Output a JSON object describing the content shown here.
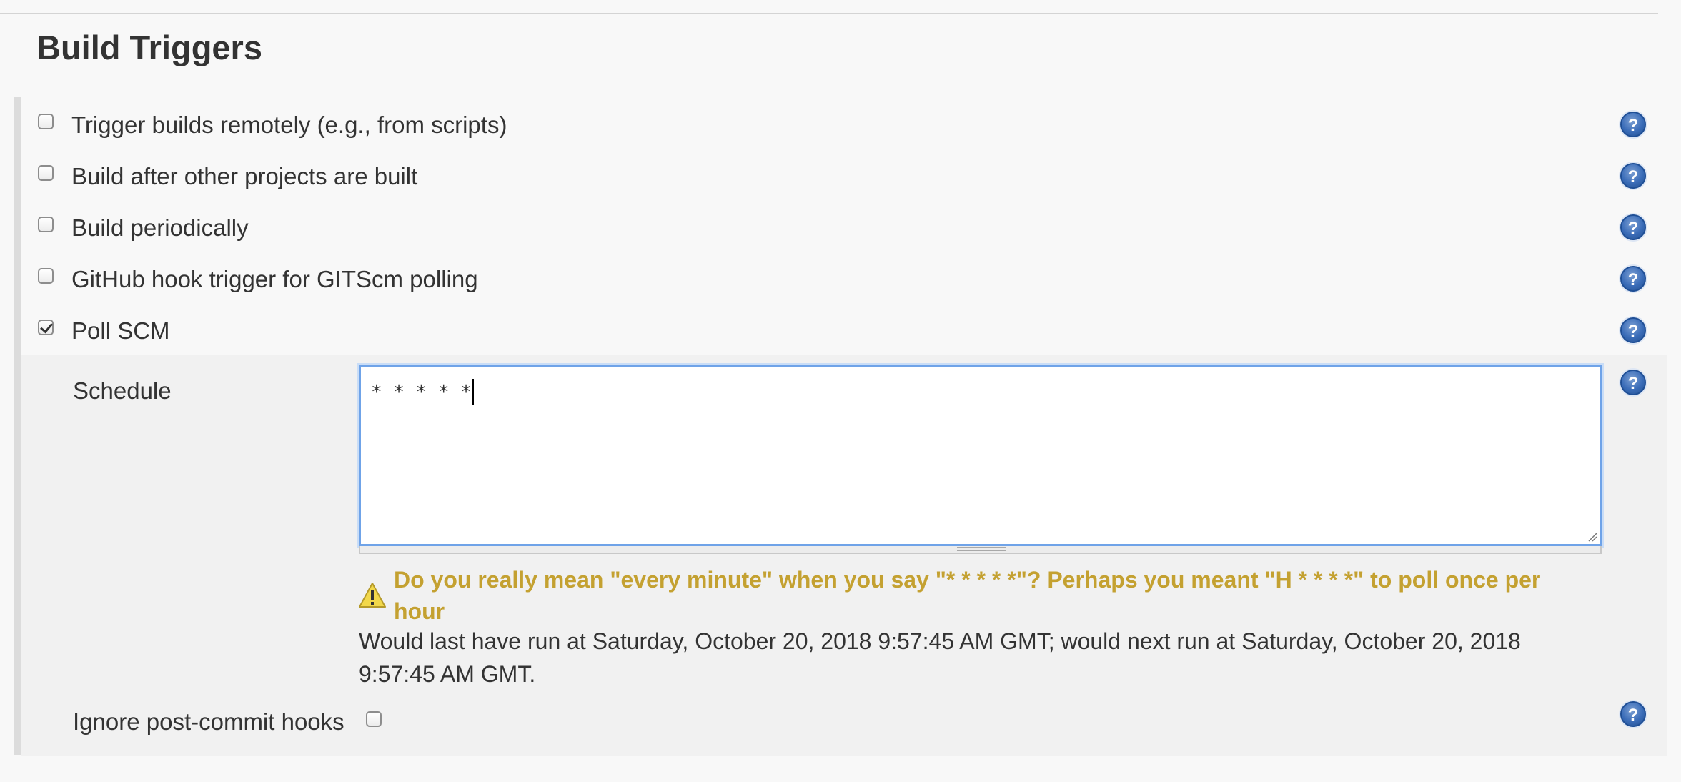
{
  "section": {
    "title": "Build Triggers"
  },
  "triggers": [
    {
      "label": "Trigger builds remotely (e.g., from scripts)",
      "checked": false
    },
    {
      "label": "Build after other projects are built",
      "checked": false
    },
    {
      "label": "Build periodically",
      "checked": false
    },
    {
      "label": "GitHub hook trigger for GITScm polling",
      "checked": false
    },
    {
      "label": "Poll SCM",
      "checked": true
    }
  ],
  "poll_scm": {
    "schedule_label": "Schedule",
    "schedule_value": "* * * * *",
    "warning": "Do you really mean \"every minute\" when you say \"* * * * *\"? Perhaps you meant \"H * * * *\" to poll once per hour",
    "run_info": "Would last have run at Saturday, October 20, 2018 9:57:45 AM GMT; would next run at Saturday, October 20, 2018 9:57:45 AM GMT.",
    "ignore_hooks_label": "Ignore post-commit hooks",
    "ignore_hooks_checked": false
  },
  "colors": {
    "warning_text": "#c4a131",
    "focus_border": "#6fa3e8",
    "help_icon": "#3a6cb8"
  },
  "icons": {
    "help": "help-icon",
    "warning": "warning-icon",
    "checkbox": "checkbox"
  }
}
